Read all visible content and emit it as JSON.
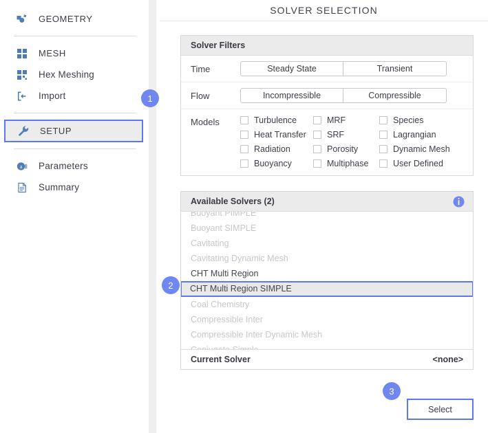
{
  "header": {
    "title": "SOLVER SELECTION"
  },
  "sidebar": {
    "groups": [
      {
        "items": [
          {
            "label": "GEOMETRY",
            "icon": "geometry-icon",
            "caps": true,
            "selected": false
          }
        ]
      },
      {
        "items": [
          {
            "label": "MESH",
            "icon": "mesh-icon",
            "caps": true,
            "selected": false
          },
          {
            "label": "Hex Meshing",
            "icon": "hex-meshing-icon",
            "caps": false,
            "selected": false
          },
          {
            "label": "Import",
            "icon": "import-icon",
            "caps": false,
            "selected": false
          }
        ]
      },
      {
        "items": [
          {
            "label": "SETUP",
            "icon": "wrench-icon",
            "caps": true,
            "selected": true
          }
        ]
      },
      {
        "items": [
          {
            "label": "Parameters",
            "icon": "parameters-icon",
            "caps": false,
            "selected": false
          },
          {
            "label": "Summary",
            "icon": "summary-icon",
            "caps": false,
            "selected": false
          }
        ]
      }
    ]
  },
  "filters": {
    "title": "Solver Filters",
    "rows": [
      {
        "label": "Time",
        "options": [
          {
            "label": "Steady State",
            "on": false
          },
          {
            "label": "Transient",
            "on": false
          }
        ]
      },
      {
        "label": "Flow",
        "options": [
          {
            "label": "Incompressible",
            "on": false
          },
          {
            "label": "Compressible",
            "on": false
          }
        ]
      }
    ],
    "models_label": "Models",
    "models": [
      {
        "label": "Turbulence",
        "checked": false
      },
      {
        "label": "MRF",
        "checked": false
      },
      {
        "label": "Species",
        "checked": false
      },
      {
        "label": "Heat Transfer",
        "checked": false
      },
      {
        "label": "SRF",
        "checked": false
      },
      {
        "label": "Lagrangian",
        "checked": false
      },
      {
        "label": "Radiation",
        "checked": false
      },
      {
        "label": "Porosity",
        "checked": false
      },
      {
        "label": "Dynamic Mesh",
        "checked": false
      },
      {
        "label": "Buoyancy",
        "checked": false
      },
      {
        "label": "Multiphase",
        "checked": false
      },
      {
        "label": "User Defined",
        "checked": false
      }
    ]
  },
  "solvers": {
    "title": "Available Solvers (2)",
    "info_icon": "info-icon",
    "items": [
      {
        "label": "Buoyant PIMPLE",
        "enabled": false,
        "selected": false
      },
      {
        "label": "Buoyant SIMPLE",
        "enabled": false,
        "selected": false
      },
      {
        "label": "Cavitating",
        "enabled": false,
        "selected": false
      },
      {
        "label": "Cavitating Dynamic Mesh",
        "enabled": false,
        "selected": false
      },
      {
        "label": "CHT Multi Region",
        "enabled": true,
        "selected": false
      },
      {
        "label": "CHT Multi Region SIMPLE",
        "enabled": true,
        "selected": true
      },
      {
        "label": "Coal Chemistry",
        "enabled": false,
        "selected": false
      },
      {
        "label": "Compressible Inter",
        "enabled": false,
        "selected": false
      },
      {
        "label": "Compressible Inter Dynamic Mesh",
        "enabled": false,
        "selected": false
      },
      {
        "label": "Conjugate Simple",
        "enabled": false,
        "selected": false
      }
    ],
    "current_label": "Current Solver",
    "current_value": "<none>"
  },
  "actions": {
    "select_label": "Select"
  },
  "badges": [
    {
      "number": "1"
    },
    {
      "number": "2"
    },
    {
      "number": "3"
    }
  ],
  "colors": {
    "accent": "#5b78ef",
    "badge": "#6f87ef",
    "icon_blue": "#4f7cb8",
    "selected_row": "#e9e9ea"
  }
}
